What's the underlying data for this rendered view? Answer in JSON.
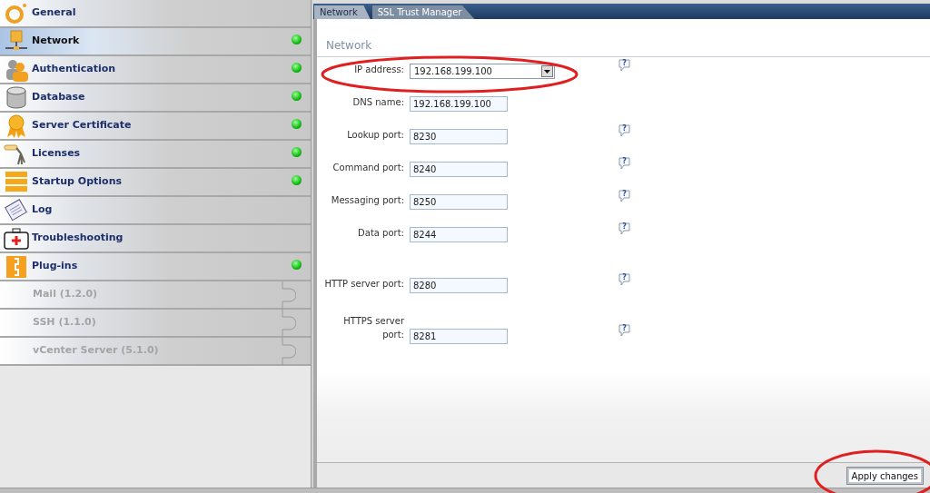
{
  "sidebar": {
    "items": [
      {
        "label": "General",
        "kind": "ring",
        "selected": false,
        "status_ok": false
      },
      {
        "label": "Network",
        "kind": "network",
        "selected": true,
        "status_ok": true
      },
      {
        "label": "Authentication",
        "kind": "users",
        "selected": false,
        "status_ok": true
      },
      {
        "label": "Database",
        "kind": "database",
        "selected": false,
        "status_ok": true
      },
      {
        "label": "Server Certificate",
        "kind": "ribbon",
        "selected": false,
        "status_ok": true
      },
      {
        "label": "Licenses",
        "kind": "keys",
        "selected": false,
        "status_ok": true
      },
      {
        "label": "Startup Options",
        "kind": "stack",
        "selected": false,
        "status_ok": true
      },
      {
        "label": "Log",
        "kind": "log",
        "selected": false,
        "status_ok": false
      },
      {
        "label": "Troubleshooting",
        "kind": "firstaid",
        "selected": false,
        "status_ok": false
      },
      {
        "label": "Plug-ins",
        "kind": "plugin",
        "selected": false,
        "status_ok": true,
        "children": [
          {
            "label": "Mail (1.2.0)",
            "disabled": true
          },
          {
            "label": "SSH (1.1.0)",
            "disabled": true
          },
          {
            "label": "vCenter Server (5.1.0)",
            "disabled": true
          }
        ]
      }
    ]
  },
  "tabs": [
    {
      "label": "Network",
      "selected": true
    },
    {
      "label": "SSL Trust Manager",
      "selected": false
    }
  ],
  "section_title": "Network",
  "fields": [
    {
      "label": "IP address:",
      "kind": "select",
      "value": "192.168.199.100",
      "help": "?"
    },
    {
      "label": "DNS name:",
      "kind": "text",
      "value": "192.168.199.100"
    },
    {
      "label": "Lookup port:",
      "kind": "text",
      "value": "8230",
      "help": "?"
    },
    {
      "label": "Command port:",
      "kind": "text",
      "value": "8240",
      "help": "?"
    },
    {
      "label": "Messaging port:",
      "kind": "text",
      "value": "8250",
      "help": "?"
    },
    {
      "label": "Data port:",
      "kind": "text",
      "value": "8244",
      "help": "?"
    },
    {
      "label": "HTTP server port:",
      "kind": "text",
      "value": "8280",
      "help": "?"
    },
    {
      "label": "HTTPS server port:",
      "kind": "text",
      "value": "8281",
      "help": "?"
    }
  ],
  "apply_button": "Apply changes"
}
